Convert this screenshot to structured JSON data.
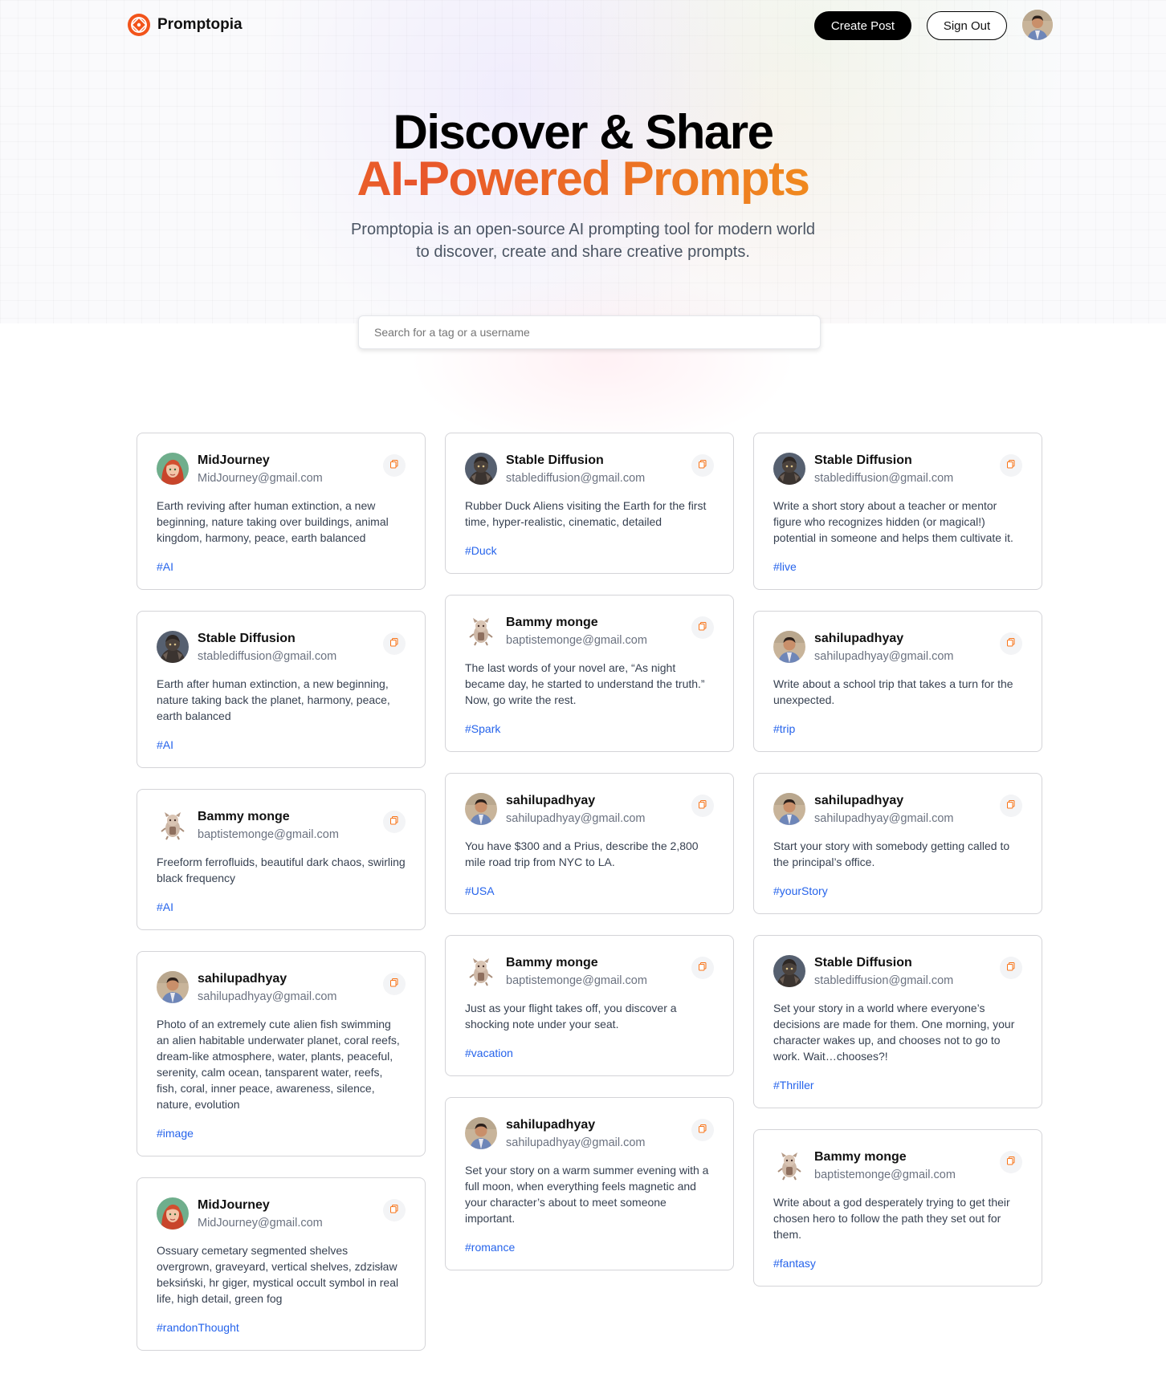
{
  "brand": {
    "name": "Promptopia"
  },
  "nav": {
    "create_label": "Create Post",
    "signout_label": "Sign Out"
  },
  "hero": {
    "title_line1": "Discover & Share",
    "title_line2": "AI-Powered Prompts",
    "subtitle": "Promptopia is an open-source AI prompting tool for modern world to discover, create and share creative prompts."
  },
  "search": {
    "placeholder": "Search for a tag or a username"
  },
  "colors": {
    "accent": "#f97316",
    "tag": "#2563eb"
  },
  "cards": [
    {
      "name": "MidJourney",
      "email": "MidJourney@gmail.com",
      "avatar": "midjourney",
      "text": "Earth reviving after human extinction, a new beginning, nature taking over buildings, animal kingdom, harmony, peace, earth balanced",
      "tag": "#AI"
    },
    {
      "name": "Stable Diffusion",
      "email": "stablediffusion@gmail.com",
      "avatar": "stable",
      "text": "Rubber Duck Aliens visiting the Earth for the first time, hyper-realistic, cinematic, detailed",
      "tag": "#Duck"
    },
    {
      "name": "Stable Diffusion",
      "email": "stablediffusion@gmail.com",
      "avatar": "stable",
      "text": "Write a short story about a teacher or mentor figure who recognizes hidden (or magical!) potential in someone and helps them cultivate it.",
      "tag": "#live"
    },
    {
      "name": "Stable Diffusion",
      "email": "stablediffusion@gmail.com",
      "avatar": "stable",
      "text": "Earth after human extinction, a new beginning, nature taking back the planet, harmony, peace, earth balanced",
      "tag": "#AI"
    },
    {
      "name": "Bammy monge",
      "email": "baptistemonge@gmail.com",
      "avatar": "bammy",
      "text": "The last words of your novel are, “As night became day, he started to understand the truth.” Now, go write the rest.",
      "tag": "#Spark"
    },
    {
      "name": "sahilupadhyay",
      "email": "sahilupadhyay@gmail.com",
      "avatar": "sahil",
      "text": "Write about a school trip that takes a turn for the unexpected.",
      "tag": "#trip"
    },
    {
      "name": "Bammy monge",
      "email": "baptistemonge@gmail.com",
      "avatar": "bammy",
      "text": "Freeform ferrofluids, beautiful dark chaos, swirling black frequency",
      "tag": "#AI"
    },
    {
      "name": "sahilupadhyay",
      "email": "sahilupadhyay@gmail.com",
      "avatar": "sahil",
      "text": "You have $300 and a Prius, describe the 2,800 mile road trip from NYC to LA.",
      "tag": "#USA"
    },
    {
      "name": "sahilupadhyay",
      "email": "sahilupadhyay@gmail.com",
      "avatar": "sahil",
      "text": "Start your story with somebody getting called to the principal’s office.",
      "tag": "#yourStory"
    },
    {
      "name": "sahilupadhyay",
      "email": "sahilupadhyay@gmail.com",
      "avatar": "sahil",
      "text": "Photo of an extremely cute alien fish swimming an alien habitable underwater planet, coral reefs, dream-like atmosphere, water, plants, peaceful, serenity, calm ocean, tansparent water, reefs, fish, coral, inner peace, awareness, silence, nature, evolution",
      "tag": "#image"
    },
    {
      "name": "Bammy monge",
      "email": "baptistemonge@gmail.com",
      "avatar": "bammy",
      "text": "Just as your flight takes off, you discover a shocking note under your seat.",
      "tag": "#vacation"
    },
    {
      "name": "Stable Diffusion",
      "email": "stablediffusion@gmail.com",
      "avatar": "stable",
      "text": "Set your story in a world where everyone’s decisions are made for them. One morning, your character wakes up, and chooses not to go to work. Wait…chooses?!",
      "tag": "#Thriller"
    },
    {
      "name": "MidJourney",
      "email": "MidJourney@gmail.com",
      "avatar": "midjourney",
      "text": "Ossuary cemetary segmented shelves overgrown, graveyard, vertical shelves, zdzisław beksiński, hr giger, mystical occult symbol in real life, high detail, green fog",
      "tag": "#randonThought"
    },
    {
      "name": "sahilupadhyay",
      "email": "sahilupadhyay@gmail.com",
      "avatar": "sahil",
      "text": "Set your story on a warm summer evening with a full moon, when everything feels magnetic and your character’s about to meet someone important.",
      "tag": "#romance"
    },
    {
      "name": "Bammy monge",
      "email": "baptistemonge@gmail.com",
      "avatar": "bammy",
      "text": "Write about a god desperately trying to get their chosen hero to follow the path they set out for them.",
      "tag": "#fantasy"
    }
  ]
}
